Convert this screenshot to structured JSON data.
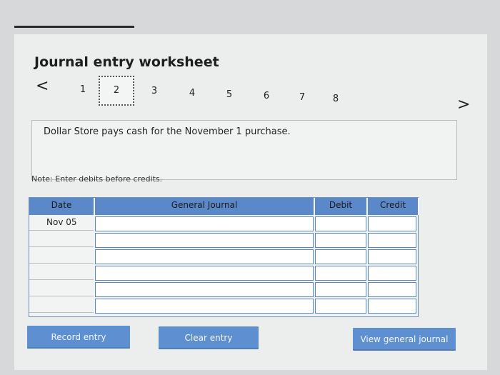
{
  "page": {
    "title": "Journal entry worksheet"
  },
  "nav": {
    "prev_arrow": "<",
    "next_arrow": ">",
    "steps": [
      "1",
      "2",
      "3",
      "4",
      "5",
      "6",
      "7",
      "8"
    ],
    "current_step": "2"
  },
  "prompt": {
    "text": "Dollar Store pays cash for the November 1 purchase."
  },
  "note": {
    "text": "Note: Enter debits before credits."
  },
  "journal": {
    "columns": {
      "date": "Date",
      "general_journal": "General Journal",
      "debit": "Debit",
      "credit": "Credit"
    },
    "rows": [
      {
        "date": "Nov 05",
        "account": "",
        "debit": "",
        "credit": ""
      },
      {
        "date": "",
        "account": "",
        "debit": "",
        "credit": ""
      },
      {
        "date": "",
        "account": "",
        "debit": "",
        "credit": ""
      },
      {
        "date": "",
        "account": "",
        "debit": "",
        "credit": ""
      },
      {
        "date": "",
        "account": "",
        "debit": "",
        "credit": ""
      },
      {
        "date": "",
        "account": "",
        "debit": "",
        "credit": ""
      }
    ]
  },
  "buttons": {
    "record": "Record entry",
    "clear": "Clear entry",
    "view": "View general journal"
  }
}
